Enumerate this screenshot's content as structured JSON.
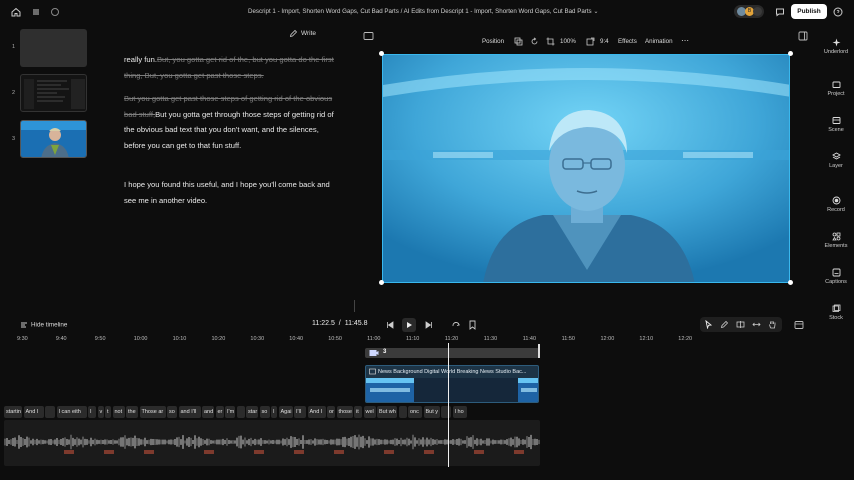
{
  "top_bar": {
    "title": "Descript 1 - Import, Shorten Word Gaps, Cut Bad Parts  /  AI Edits from Descript 1 - Import, Shorten Word Gaps, Cut Bad Parts ⌄",
    "publish_label": "Publish",
    "avatar_letters": [
      "B"
    ]
  },
  "scenes": [
    {
      "number": "1"
    },
    {
      "number": "2"
    },
    {
      "number": "3"
    }
  ],
  "script": {
    "write_label": "Write",
    "p1": {
      "text_a": "really fun.",
      "struck": "But, you gotta get rid of the, but you gotta do the first thing, But, you gotta get past those steps."
    },
    "p2": {
      "struck": "But you gotta get past those steps of getting rid of the obvious bad stuff,",
      "text": "But you gotta get through those steps of getting rid of the obvious bad text that you don't want, and the silences, before you can get to that fun stuff."
    },
    "p3": {
      "text": "I hope you found this useful, and I hope you'll come back and see me in another video."
    }
  },
  "preview_toolbar": {
    "position": "Position",
    "zoom": "100%",
    "aspect": "9:4",
    "effects": "Effects",
    "animation": "Animation"
  },
  "right_rail": [
    {
      "label": "Underlord",
      "icon": "sparkle-icon"
    },
    {
      "label": "Project",
      "icon": "folder-icon"
    },
    {
      "label": "Scene",
      "icon": "scene-icon"
    },
    {
      "label": "Layer",
      "icon": "layers-icon"
    },
    {
      "label": "Record",
      "icon": "record-icon"
    },
    {
      "label": "Elements",
      "icon": "elements-icon"
    },
    {
      "label": "Captions",
      "icon": "captions-icon"
    },
    {
      "label": "Stock",
      "icon": "stock-icon"
    }
  ],
  "timeline": {
    "hide_label": "Hide timeline",
    "current_time": "11:22.5",
    "separator": "/",
    "total_time": "11:45.8",
    "ruler": [
      "9:30",
      "9:40",
      "9:50",
      "10:00",
      "10:10",
      "10:20",
      "10:30",
      "10:40",
      "10:50",
      "11:00",
      "11:10",
      "11:20",
      "11:30",
      "11:40",
      "11:50",
      "12:00",
      "12:10",
      "12:20"
    ],
    "scene_label": "3",
    "clip_title": "News Background Digital World Breaking News Studio Bac...",
    "words": [
      "startin",
      "And I",
      "",
      "I can eith",
      "I",
      "v",
      "t",
      "not",
      "the",
      "Those ar",
      "so",
      "and I'll",
      "and",
      "er",
      "I'm",
      "",
      "star",
      "so",
      "I",
      "Agai",
      "I'll",
      "And I",
      "or",
      "those",
      "it",
      "wel",
      "But wh",
      "",
      "onc",
      "But y",
      "",
      "I ho"
    ]
  }
}
